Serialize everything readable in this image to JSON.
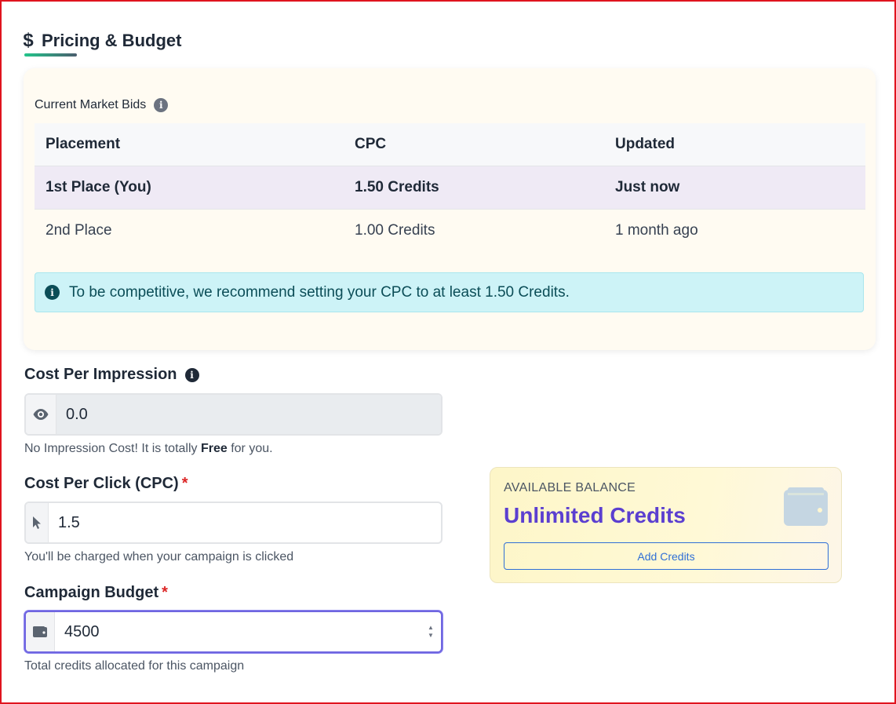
{
  "section": {
    "title": "Pricing & Budget",
    "icon": "dollar-icon"
  },
  "market_bids": {
    "label": "Current Market Bids",
    "columns": [
      "Placement",
      "CPC",
      "Updated"
    ],
    "rows": [
      {
        "placement": "1st Place (You)",
        "cpc": "1.50 Credits",
        "updated": "Just now"
      },
      {
        "placement": "2nd Place",
        "cpc": "1.00 Credits",
        "updated": "1 month ago"
      }
    ],
    "alert": "To be competitive, we recommend setting your CPC to at least 1.50 Credits."
  },
  "cost_per_impression": {
    "label": "Cost Per Impression",
    "value": "0.0",
    "help_prefix": "No Impression Cost! It is totally ",
    "help_bold": "Free",
    "help_suffix": " for you."
  },
  "cost_per_click": {
    "label": "Cost Per Click (CPC)",
    "required": "*",
    "value": "1.5",
    "help": "You'll be charged when your campaign is clicked"
  },
  "campaign_budget": {
    "label": "Campaign Budget",
    "required": "*",
    "value": "4500",
    "help": "Total credits allocated for this campaign"
  },
  "balance": {
    "label": "AVAILABLE BALANCE",
    "value": "Unlimited Credits",
    "button": "Add Credits"
  },
  "colors": {
    "accent": "#5b3fd0",
    "alert_bg": "#cdf3f7",
    "required": "#dc2626",
    "button": "#2f6fd6"
  }
}
